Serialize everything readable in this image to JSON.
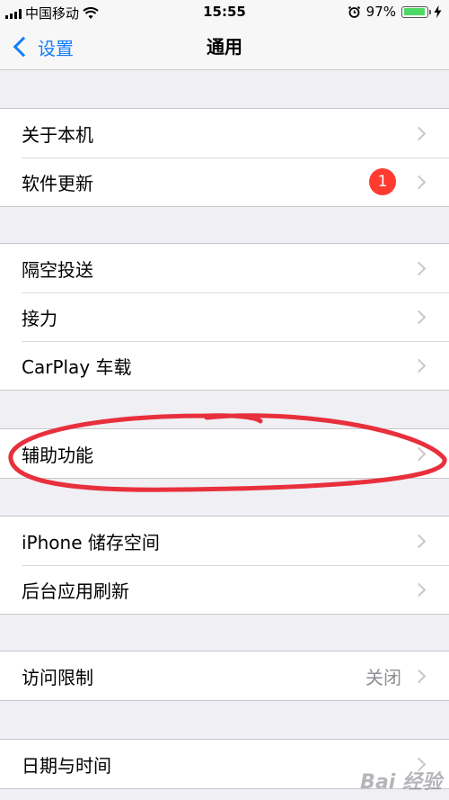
{
  "status_bar": {
    "carrier": "中国移动",
    "time": "15:55",
    "battery_percent": "97%",
    "battery_level": 0.97
  },
  "nav": {
    "back_label": "设置",
    "title": "通用"
  },
  "groups": [
    {
      "items": [
        {
          "label": "关于本机"
        },
        {
          "label": "软件更新",
          "badge": "1"
        }
      ]
    },
    {
      "items": [
        {
          "label": "隔空投送"
        },
        {
          "label": "接力"
        },
        {
          "label": "CarPlay 车载"
        }
      ]
    },
    {
      "items": [
        {
          "label": "辅助功能"
        }
      ]
    },
    {
      "items": [
        {
          "label": "iPhone 储存空间"
        },
        {
          "label": "后台应用刷新"
        }
      ]
    },
    {
      "items": [
        {
          "label": "访问限制",
          "value": "关闭"
        }
      ]
    },
    {
      "items": [
        {
          "label": "日期与时间"
        }
      ]
    }
  ],
  "annotation": {
    "color": "#e8303c"
  },
  "watermark": "Bai 经验"
}
